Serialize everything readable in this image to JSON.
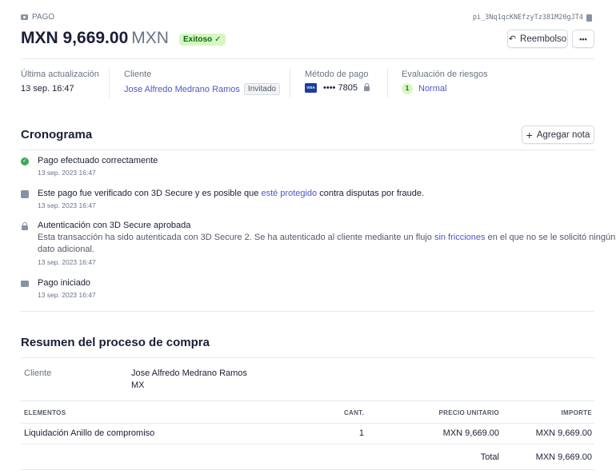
{
  "header": {
    "kind": "PAGO",
    "payment_id": "pi_3Nq1qcKNEfzyTz381M20gJT4",
    "amount": "MXN 9,669.00",
    "currency": "MXN",
    "status": "Exitoso"
  },
  "actions": {
    "refund": "Reembolso",
    "more": "•••"
  },
  "summary": {
    "last_update_label": "Última actualización",
    "last_update_value": "13 sep. 16:47",
    "customer_label": "Cliente",
    "customer_name": "Jose Alfredo Medrano Ramos",
    "customer_badge": "Invitado",
    "payment_method_label": "Método de pago",
    "card_brand": "VISA",
    "card_last4": "•••• 7805",
    "risk_label": "Evaluación de riesgos",
    "risk_score": "1",
    "risk_value": "Normal"
  },
  "timeline": {
    "title": "Cronograma",
    "add_note": "Agregar nota",
    "events": [
      {
        "title": "Pago efectuado correctamente",
        "time": "13 sep. 2023 16:47"
      },
      {
        "title_pre": "Este pago fue verificado con 3D Secure y es posible que ",
        "title_link": "esté protegido",
        "title_post": " contra disputas por fraude.",
        "time": "13 sep. 2023 16:47"
      },
      {
        "title": "Autenticación con 3D Secure aprobada",
        "desc_pre": "Esta transacción ha sido autenticada con 3D Secure 2. Se ha autenticado al cliente mediante un flujo ",
        "desc_link": "sin fricciones",
        "desc_post": " en el que no se le solicitó ningún",
        "desc_line2": "dato adicional.",
        "time": "13 sep. 2023 16:47"
      },
      {
        "title": "Pago iniciado",
        "time": "13 sep. 2023 16:47"
      }
    ]
  },
  "checkout": {
    "title": "Resumen del proceso de compra",
    "customer_label": "Cliente",
    "customer_name": "Jose Alfredo Medrano Ramos",
    "customer_country": "MX",
    "columns": [
      "ELEMENTOS",
      "CANT.",
      "PRECIO UNITARIO",
      "IMPORTE"
    ],
    "items": [
      {
        "name": "Liquidación Anillo de compromiso",
        "qty": "1",
        "unit_price": "MXN 9,669.00",
        "amount": "MXN 9,669.00"
      }
    ],
    "total_label": "Total",
    "total_value": "MXN 9,669.00"
  }
}
